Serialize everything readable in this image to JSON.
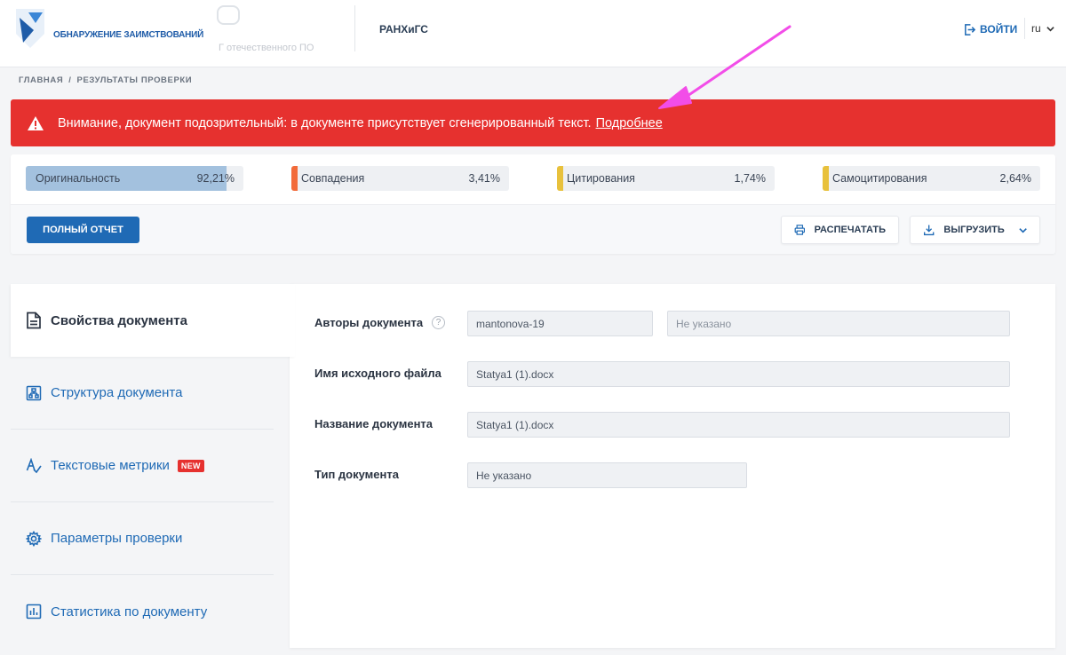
{
  "header": {
    "logo_text": "ОБНАРУЖЕНИЕ ЗАИМСТВОВАНИЙ",
    "logo2_text": "Г отечественного ПО",
    "org_name": "РАНХиГС",
    "login_label": "ВОЙТИ",
    "language": "ru",
    "icons": [
      "logo-mark-icon",
      "login-icon",
      "chevron-down-icon"
    ]
  },
  "breadcrumb": {
    "items": [
      "ГЛАВНАЯ",
      "РЕЗУЛЬТАТЫ ПРОВЕРКИ"
    ],
    "separator": "/"
  },
  "alert": {
    "text": "Внимание, документ подозрительный: в документе присутствует сгенерированный текст.",
    "link": "Подробнее",
    "icon": "warning-icon",
    "color": "#e6312f"
  },
  "stats": [
    {
      "label": "Оригинальность",
      "value": "92,21%",
      "fill": 0.9221,
      "color": "#a3c1de"
    },
    {
      "label": "Совпадения",
      "value": "3,41%",
      "color": "#f26b3a"
    },
    {
      "label": "Цитирования",
      "value": "1,74%",
      "color": "#e8c13c"
    },
    {
      "label": "Самоцитирования",
      "value": "2,64%",
      "color": "#e8c13c"
    }
  ],
  "actions": {
    "full_report": "ПОЛНЫЙ ОТЧЕТ",
    "print": "РАСПЕЧАТАТЬ",
    "export": "ВЫГРУЗИТЬ"
  },
  "sidebar": {
    "items": [
      {
        "label": "Свойства документа",
        "icon": "document-icon",
        "active": true
      },
      {
        "label": "Структура документа",
        "icon": "structure-icon"
      },
      {
        "label": "Текстовые метрики",
        "icon": "metrics-icon",
        "badge": "NEW"
      },
      {
        "label": "Параметры проверки",
        "icon": "gear-icon"
      },
      {
        "label": "Статистика по документу",
        "icon": "bar-chart-icon"
      }
    ]
  },
  "properties": {
    "authors_label": "Авторы документа",
    "authors_value": "mantonova-19",
    "authors_placeholder": "Не указано",
    "filename_label": "Имя исходного файла",
    "filename_value": "Statya1 (1).docx",
    "title_label": "Название документа",
    "title_value": "Statya1 (1).docx",
    "type_label": "Тип документа",
    "type_value": "Не указано"
  },
  "colors": {
    "primary": "#1f6ab5",
    "alert": "#e6312f",
    "annotation_arrow": "#f24de8"
  }
}
